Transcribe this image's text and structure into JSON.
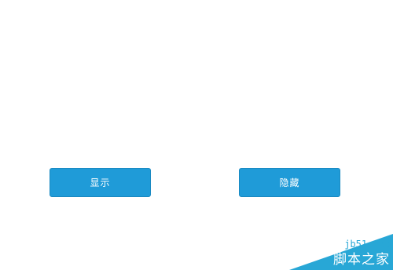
{
  "buttons": {
    "show_label": "显示",
    "hide_label": "隐藏"
  },
  "watermark": {
    "url": "jb51.net",
    "site_name": "脚本之家"
  },
  "colors": {
    "button_bg": "#1f9bd8",
    "button_text": "#ffffff",
    "watermark_accent": "#28a7d6"
  }
}
